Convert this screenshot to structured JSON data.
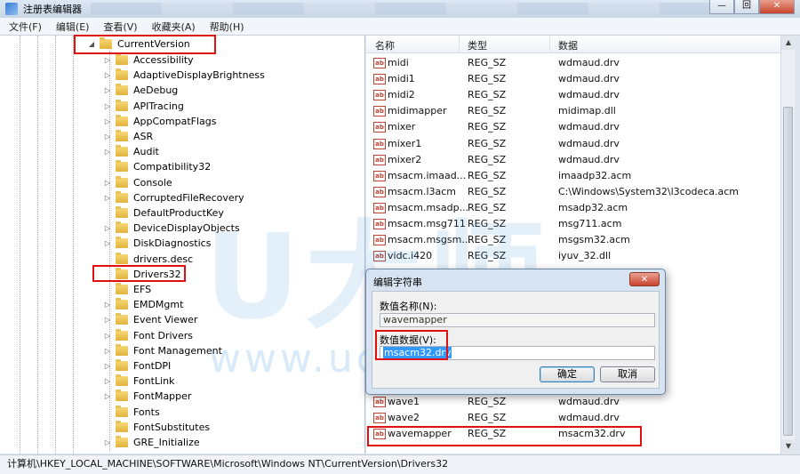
{
  "window": {
    "title": "注册表编辑器",
    "minimize": "—",
    "maximize": "回",
    "close": "✕"
  },
  "menu": [
    "文件(F)",
    "编辑(E)",
    "查看(V)",
    "收藏夹(A)",
    "帮助(H)"
  ],
  "tree": {
    "parent": "CurrentVersion",
    "items": [
      "Accessibility",
      "AdaptiveDisplayBrightness",
      "AeDebug",
      "APITracing",
      "AppCompatFlags",
      "ASR",
      "Audit",
      "Compatibility32",
      "Console",
      "CorruptedFileRecovery",
      "DefaultProductKey",
      "DeviceDisplayObjects",
      "DiskDiagnostics",
      "drivers.desc",
      "Drivers32",
      "EFS",
      "EMDMgmt",
      "Event Viewer",
      "Font Drivers",
      "Font Management",
      "FontDPI",
      "FontLink",
      "FontMapper",
      "Fonts",
      "FontSubstitutes",
      "GRE_Initialize"
    ]
  },
  "columns": {
    "name": "名称",
    "type": "类型",
    "data": "数据"
  },
  "values": [
    {
      "name": "midi",
      "type": "REG_SZ",
      "data": "wdmaud.drv"
    },
    {
      "name": "midi1",
      "type": "REG_SZ",
      "data": "wdmaud.drv"
    },
    {
      "name": "midi2",
      "type": "REG_SZ",
      "data": "wdmaud.drv"
    },
    {
      "name": "midimapper",
      "type": "REG_SZ",
      "data": "midimap.dll"
    },
    {
      "name": "mixer",
      "type": "REG_SZ",
      "data": "wdmaud.drv"
    },
    {
      "name": "mixer1",
      "type": "REG_SZ",
      "data": "wdmaud.drv"
    },
    {
      "name": "mixer2",
      "type": "REG_SZ",
      "data": "wdmaud.drv"
    },
    {
      "name": "msacm.imaad...",
      "type": "REG_SZ",
      "data": "imaadp32.acm"
    },
    {
      "name": "msacm.l3acm",
      "type": "REG_SZ",
      "data": "C:\\Windows\\System32\\l3codeca.acm"
    },
    {
      "name": "msacm.msadp...",
      "type": "REG_SZ",
      "data": "msadp32.acm"
    },
    {
      "name": "msacm.msg711",
      "type": "REG_SZ",
      "data": "msg711.acm"
    },
    {
      "name": "msacm.msgsm...",
      "type": "REG_SZ",
      "data": "msgsm32.acm"
    },
    {
      "name": "vidc.i420",
      "type": "REG_SZ",
      "data": "iyuv_32.dll"
    }
  ],
  "values_bottom": [
    {
      "name": "wave1",
      "type": "REG_SZ",
      "data": "wdmaud.drv"
    },
    {
      "name": "wave2",
      "type": "REG_SZ",
      "data": "wdmaud.drv"
    },
    {
      "name": "wavemapper",
      "type": "REG_SZ",
      "data": "msacm32.drv"
    }
  ],
  "dialog": {
    "title": "编辑字符串",
    "close": "✕",
    "name_label": "数值名称(N):",
    "name_value": "wavemapper",
    "data_label": "数值数据(V):",
    "data_value": "msacm32.drv",
    "ok": "确定",
    "cancel": "取消"
  },
  "statusbar": "计算机\\HKEY_LOCAL_MACHINE\\SOFTWARE\\Microsoft\\Windows NT\\CurrentVersion\\Drivers32",
  "watermark": {
    "big": "U大师",
    "url": "www.udashi.com"
  },
  "icons": {
    "reg_value": "ab-string-icon",
    "folder": "folder-icon"
  },
  "colors": {
    "highlight_box": "#e01010",
    "selection": "#3399ff"
  }
}
